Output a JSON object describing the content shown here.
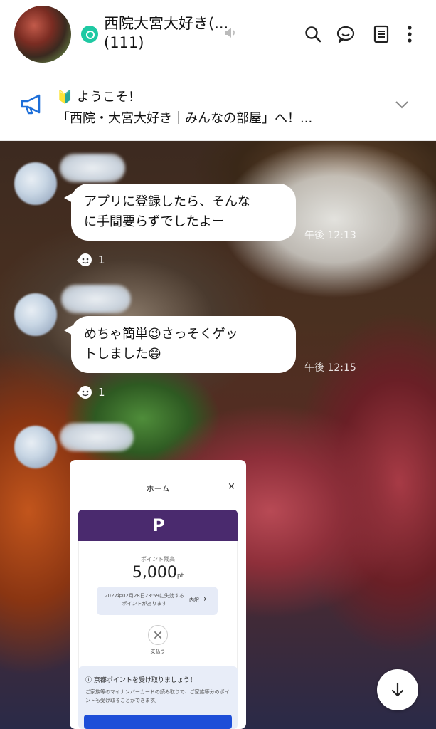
{
  "header": {
    "title": "西院大宮大好き(...  (111)",
    "icons": [
      "avatar",
      "open-chat-icon",
      "mute-icon",
      "search-icon",
      "chat-icon",
      "notes-icon",
      "more-icon"
    ]
  },
  "announcement": {
    "line1": "🔰 ようこそ！",
    "line2": "「西院・大宮大好き｜みんなの部屋」へ！..."
  },
  "messages": [
    {
      "text": "アプリに登録したら、そんなに手間要らずでしたよー",
      "line1": "アプリに登録したら、そんな",
      "line2": "に手間要らずでしたよー",
      "time": "午後 12:13",
      "reactions": "1"
    },
    {
      "text": "めちゃ簡単😉さっそくゲットしました😄",
      "line1": "めちゃ簡単😉さっそくゲッ",
      "line2": "トしました😄",
      "time": "午後 12:15",
      "reactions": "1"
    }
  ],
  "image_card": {
    "title": "ホーム",
    "close": "×",
    "logo": "P",
    "points_label": "ポイント残高",
    "points_value": "5,000",
    "points_unit": "pt",
    "expire_text": "2027年02月28日23:59に失効するポイントがあります",
    "expire_link": "内訳",
    "pay_label": "支払う",
    "notice_title": "ⓘ 京都ポイントを受け取りましょう！",
    "notice_body": "ご家族等のマイナンバーカードの読み取りで、ご家族等分のポイントも受け取ることができます。"
  },
  "colors": {
    "accent": "#1fc9a3",
    "card_header": "#4a2a6e",
    "bubble": "#ffffff"
  }
}
